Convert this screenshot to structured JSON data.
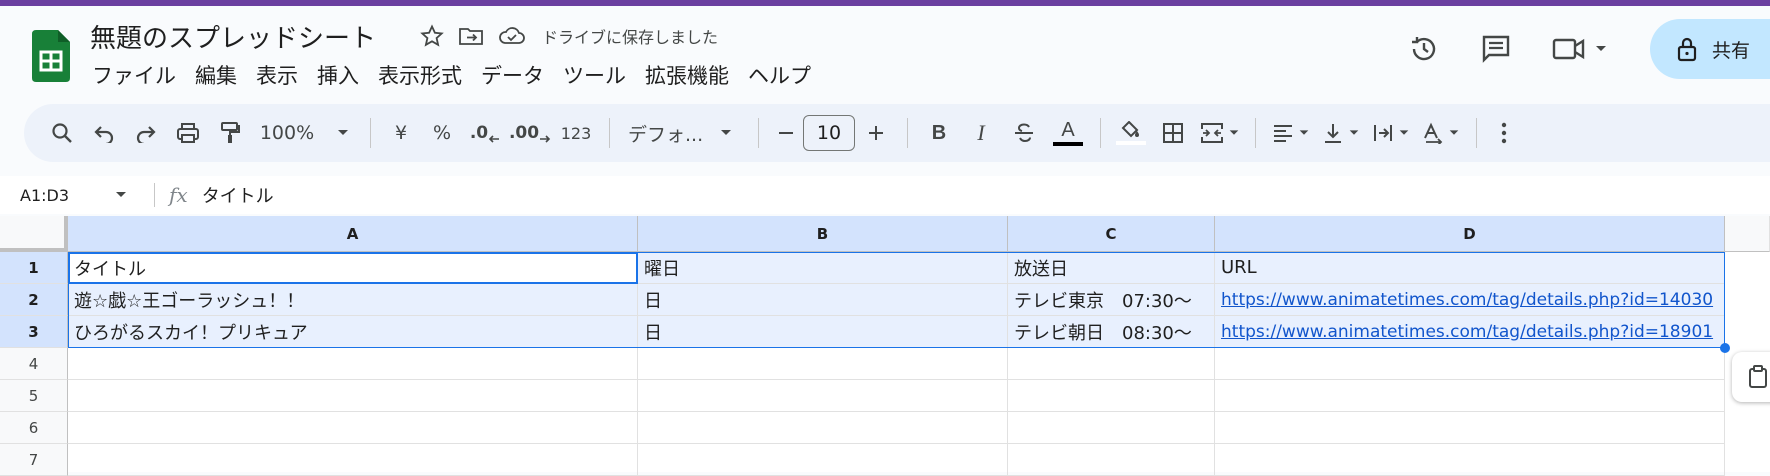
{
  "doc": {
    "title": "無題のスプレッドシート",
    "save_status": "ドライブに保存しました"
  },
  "menu": [
    "ファイル",
    "編集",
    "表示",
    "挿入",
    "表示形式",
    "データ",
    "ツール",
    "拡張機能",
    "ヘルプ"
  ],
  "header": {
    "share_label": "共有"
  },
  "toolbar": {
    "zoom": "100%",
    "currency": "¥",
    "percent": "%",
    "dec_decrease": ".0",
    "dec_increase": ".00",
    "number_format": "123",
    "font": "デフォ...",
    "font_size": "10",
    "bold": "B",
    "italic": "I",
    "text_color": "A"
  },
  "formula_bar": {
    "name_box": "A1:D3",
    "fx": "fx",
    "value": "タイトル"
  },
  "columns": [
    "A",
    "B",
    "C",
    "D"
  ],
  "rows": [
    "1",
    "2",
    "3",
    "4",
    "5",
    "6",
    "7"
  ],
  "cells": [
    [
      "タイトル",
      "曜日",
      "放送日",
      "URL"
    ],
    [
      "遊☆戯☆王ゴーラッシュ！！",
      "日",
      "テレビ東京　07:30～",
      "https://www.animatetimes.com/tag/details.php?id=14030"
    ],
    [
      "ひろがるスカイ！プリキュア",
      "日",
      "テレビ朝日　08:30～",
      "https://www.animatetimes.com/tag/details.php?id=18901"
    ]
  ],
  "colors": {
    "accent": "#6b3fa0",
    "selection": "#1a73e8",
    "header_selected": "#d3e3fd",
    "share_bg": "#c2e7ff",
    "logo": "#188038"
  }
}
